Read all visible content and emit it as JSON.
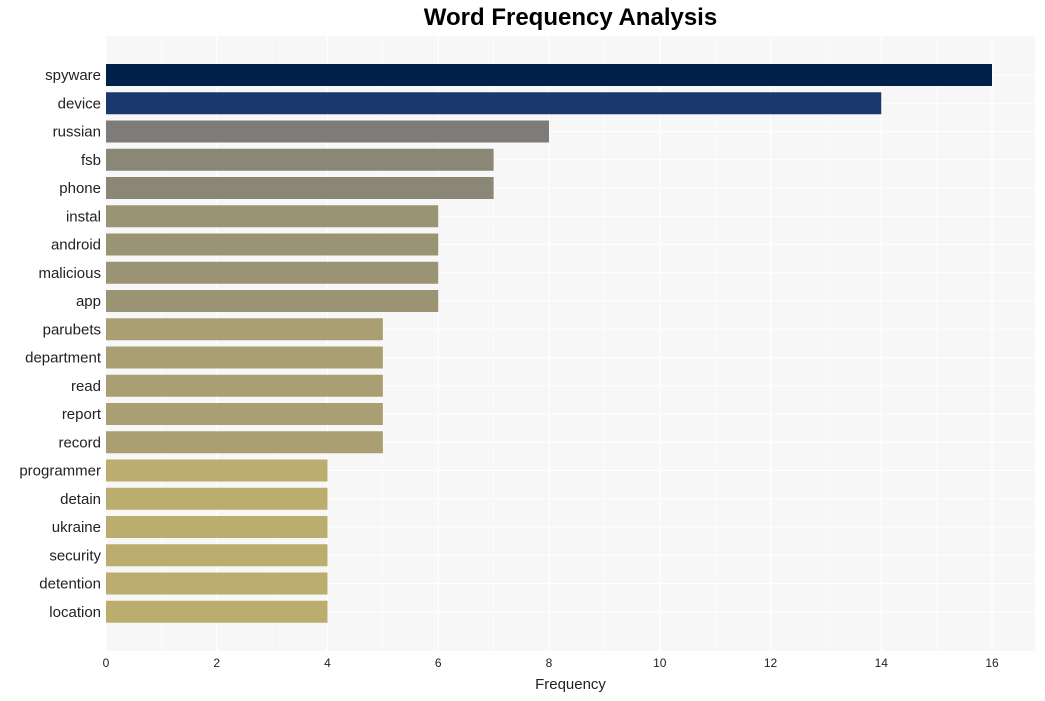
{
  "chart_data": {
    "type": "bar",
    "orientation": "horizontal",
    "title": "Word Frequency Analysis",
    "xlabel": "Frequency",
    "ylabel": "",
    "xlim": [
      0,
      16.8
    ],
    "xticks": [
      0,
      2,
      4,
      6,
      8,
      10,
      12,
      14,
      16
    ],
    "grid": true,
    "categories": [
      "spyware",
      "device",
      "russian",
      "fsb",
      "phone",
      "instal",
      "android",
      "malicious",
      "app",
      "parubets",
      "department",
      "read",
      "report",
      "record",
      "programmer",
      "detain",
      "ukraine",
      "security",
      "detention",
      "location"
    ],
    "values": [
      16,
      14,
      8,
      7,
      7,
      6,
      6,
      6,
      6,
      5,
      5,
      5,
      5,
      5,
      4,
      4,
      4,
      4,
      4,
      4
    ],
    "colors": [
      "#00204c",
      "#1a386e",
      "#7d7c78",
      "#8a8777",
      "#8a8777",
      "#9b9474",
      "#9b9474",
      "#9b9474",
      "#9b9474",
      "#aa9f72",
      "#aa9f72",
      "#aa9f72",
      "#aa9f72",
      "#aa9f72",
      "#bbad6d",
      "#bbad6d",
      "#bbad6d",
      "#bbad6d",
      "#bbad6d",
      "#bbad6d"
    ],
    "background": "#f7f7f7"
  }
}
